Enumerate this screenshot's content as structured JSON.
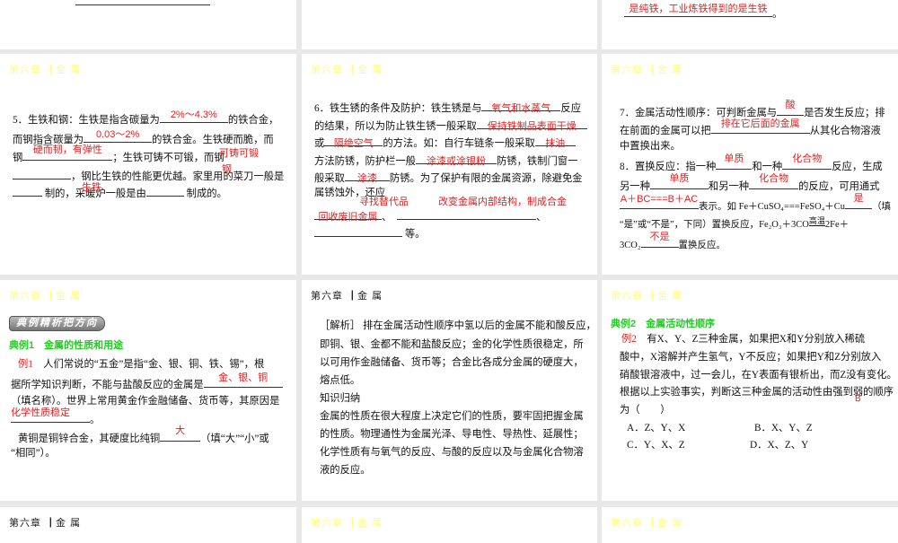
{
  "top_left": {},
  "top_right": {
    "answer": "是纯铁，工业炼铁得到的是生铁",
    "end": "。"
  },
  "header": "第六章▕  金 属",
  "s5": {
    "l1a": "5．生铁和钢：生铁是指含碳量为",
    "a1": "2%～4.3%",
    "l1b": "的铁合金，",
    "l2a": "而钢指含碳量为",
    "a2": "0.03～2%",
    "l2b": "的铁合金。生铁硬而脆，而",
    "l3a": "钢",
    "a3": "硬而韧，有弹性",
    "l3b": "；生铁可铸不可锻，而钢",
    "a4": "可铸可锻",
    "l4b": "，钢比生铁的性能更优越。家里用的菜刀一般是",
    "a5": "钢",
    "l5a": "制的，采暖炉一般是由",
    "l5b": "制成的。",
    "a6": "生铁"
  },
  "s6": {
    "l1a": "6．铁生锈的条件及防护：铁生锈是与",
    "a1": "氧气和水蒸气",
    "l1b": "反应",
    "l2a": "的结果，所以为防止铁生锈一般采取",
    "a2": "保持铁制品表面干燥",
    "l3a": "或",
    "a3": "隔绝空气",
    "l3b": "的方法。如：自行车链条一般采取",
    "a4": "抹油",
    "l4a": "方法防锈，防护栏一般",
    "a5": "涂漆或涂银粉",
    "l4b": "防锈，铁制门窗一",
    "l5a": "般采取",
    "a6": "涂漆",
    "l5b": "防锈。为了保护有限的金属资源，除避免金",
    "l6a": "属锈蚀外，还应",
    "a7": "寻找替代品",
    "a8": "改变金属内部结构，制成合金",
    "a9": "回收废旧金属",
    "sep": "、",
    "l8b": "等。"
  },
  "s7": {
    "l1a": "7．金属活动性顺序：可判断金属与",
    "a1": "酸",
    "l1b": "是否发生反应；排",
    "l2a": "在前面的金属可以把",
    "a2": "排在它后面的金属",
    "l2b": "从其化合物溶液",
    "l3": "中置换出来。",
    "l4a": "8．置换反应：指一种",
    "a3": "单质",
    "l4b": "和一种",
    "a4": "化合物",
    "l4c": "反应，生成",
    "l5a": "另一种",
    "a5": "单质",
    "l5b": "和另一种",
    "a6": "化合物",
    "l5c": "的反应，可用通式",
    "a7": "A＋BC===B＋AC",
    "l6a": "表示。如 Fe＋CuSO₄===FeSO₄＋Cu",
    "a8": "是",
    "l6b": "（填",
    "l7a": "“是”或“不是”，下同）置换反应，Fe₂O₃＋3CO",
    "cond": "高温",
    "l7b": "2Fe＋",
    "l8a": "3CO₂",
    "a9": "不是",
    "l8b": "置换反应。"
  },
  "ex1": {
    "banner": "典例精析把方向",
    "title": "典例1　金属的性质和用途",
    "tag": "例1",
    "l1": "人们常说的“五金”是指“金、银、铜、铁、锡”，根",
    "l2": "据所学知识判断，不能与盐酸反应的金属是",
    "a1": "金、银、铜",
    "l3": "（填名称）。世界上常用黄金作金融储备、货币等，其原因是",
    "a2": "化学性质稳定",
    "l4": "。",
    "l5a": "黄铜是铜锌合金，其硬度比纯铜",
    "a3": "大",
    "l5b": "（填“大”“小”或",
    "l6": "“相同”）。"
  },
  "analysis": {
    "lines": [
      "［解析］ 排在金属活动性顺序中氢以后的金属不能和酸反应，",
      "即铜、银、金都不能和盐酸反应；金的化学性质很稳定，所",
      "以可用作金融储备、货币等；合金比各成分金属的硬度大，",
      "熔点低。",
      "知识归纳",
      "金属的性质在很大程度上决定它们的性质，要牢固把握金属",
      "的性质。物理通性为金属光泽、导电性、导热性、延展性；",
      "化学性质有与氧气的反应、与酸的反应以及与金属化合物溶",
      "液的反应。"
    ]
  },
  "ex2": {
    "title": "典例2　金属活动性顺序",
    "tag": "例2",
    "l1": "有X、Y、Z三种金属，如果把X和Y分别放入稀硫",
    "l2": "酸中，X溶解并产生氢气，Y不反应；如果把Y和Z分别放入",
    "l3": "硝酸银溶液中，过一会儿，在Y表面有银析出，而Z没有变化。",
    "l4": "根据以上实验事实，判断这三种金属的活动性由强到弱的顺序",
    "l5": "为（　　）",
    "answer": "B",
    "options": [
      "A．Z、Y、X",
      "B．X、Y、Z",
      "C．Y、X、Z",
      "D．X、Z、Y"
    ]
  }
}
